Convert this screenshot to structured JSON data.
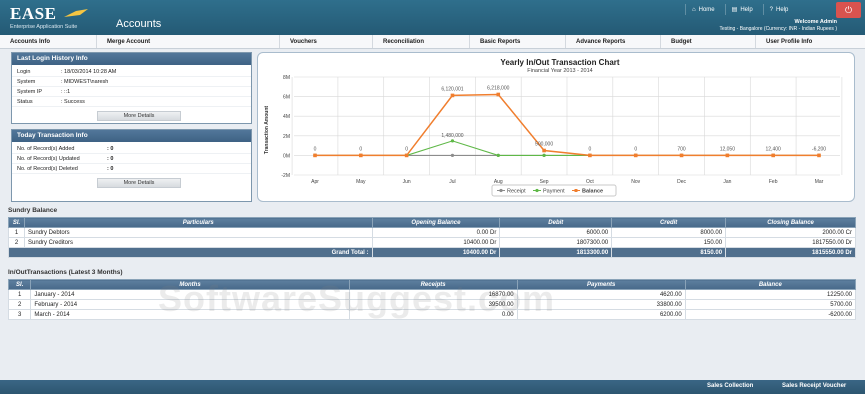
{
  "header": {
    "logo": "EASE",
    "logo_sub": "Enterprise Application Suite",
    "page_title": "Accounts",
    "links": [
      {
        "label": "Home",
        "icon": "home-icon"
      },
      {
        "label": "Help",
        "icon": "book-icon"
      },
      {
        "label": "Help",
        "icon": "question-icon"
      }
    ],
    "welcome": "Welcome Admin",
    "welcome_sub": "Testing - Bangalore (Currency: INR - Indian Rupees )"
  },
  "menu": [
    "Accounts Info",
    "Merge Account",
    "Vouchers",
    "Reconciliation",
    "Basic Reports",
    "Advance Reports",
    "Budget",
    "User Profile Info"
  ],
  "login_panel": {
    "title": "Last Login History Info",
    "rows": [
      {
        "key": "Login",
        "value": ": 18/03/2014 10:28 AM"
      },
      {
        "key": "System",
        "value": ": MIDWEST\\naresh"
      },
      {
        "key": "System IP",
        "value": ": ::1"
      },
      {
        "key": "Status",
        "value": ": Success"
      }
    ],
    "button": "More Details"
  },
  "transaction_panel": {
    "title": "Today Transaction Info",
    "rows": [
      {
        "key": "No. of Record(s) Added",
        "value": ": 0"
      },
      {
        "key": "No. of Record(s) Updated",
        "value": ": 0"
      },
      {
        "key": "No. of Record(s) Deleted",
        "value": ": 0"
      }
    ],
    "button": "More Details"
  },
  "chart_data": {
    "type": "line",
    "title": "Yearly In/Out Transaction Chart",
    "subtitle": "Financial Year 2013 - 2014",
    "ylabel": "Transaction Amount",
    "xlabel": "",
    "categories": [
      "Apr",
      "May",
      "Jun",
      "Jul",
      "Aug",
      "Sep",
      "Oct",
      "Nov",
      "Dec",
      "Jan",
      "Feb",
      "Mar"
    ],
    "ylim": [
      -2000000,
      8000000
    ],
    "yticks": [
      "8M",
      "6M",
      "4M",
      "2M",
      "0M",
      "-2M"
    ],
    "grid": true,
    "legend_position": "bottom",
    "series": [
      {
        "name": "Receipt",
        "color": "#8c8c8c",
        "values": [
          0,
          0,
          0,
          0,
          0,
          0,
          0,
          0,
          0,
          0,
          0,
          0
        ]
      },
      {
        "name": "Payment",
        "color": "#5fb847",
        "values": [
          0,
          0,
          0,
          1480000,
          0,
          0,
          0,
          0,
          0,
          0,
          0,
          0
        ]
      },
      {
        "name": "Balance",
        "color": "#f07e2e",
        "values": [
          0,
          0,
          0,
          6120000,
          6218000,
          500000,
          0,
          0,
          0,
          0,
          0,
          0
        ]
      }
    ],
    "data_labels": [
      "0",
      "0",
      "0",
      "6,120,001",
      "6,218,000",
      "500,000",
      "0",
      "0",
      "700",
      "12,050",
      "12,400",
      "-6,200"
    ],
    "payment_label": "1,480,000",
    "zero_labels": [
      "0",
      "0"
    ]
  },
  "sundry": {
    "title": "Sundry Balance",
    "headers": [
      "Sl.",
      "Particulars",
      "Opening Balance",
      "Debit",
      "Credit",
      "Closing Balance"
    ],
    "rows": [
      [
        "1",
        "Sundry Debtors",
        "0.00 Dr",
        "6000.00",
        "8000.00",
        "2000.00 Cr"
      ],
      [
        "2",
        "Sundry Creditors",
        "10400.00 Dr",
        "1807300.00",
        "150.00",
        "1817550.00 Dr"
      ]
    ],
    "total_label": "Grand Total :",
    "total": [
      "10400.00 Dr",
      "1813300.00",
      "8150.00",
      "1815550.00 Dr"
    ]
  },
  "inout": {
    "title": "In/OutTransactions (Latest 3 Months)",
    "headers": [
      "Sl.",
      "Months",
      "Receipts",
      "Payments",
      "Balance"
    ],
    "rows": [
      [
        "1",
        "January - 2014",
        "16870.00",
        "4620.00",
        "12250.00"
      ],
      [
        "2",
        "February - 2014",
        "39500.00",
        "33800.00",
        "5700.00"
      ],
      [
        "3",
        "March - 2014",
        "0.00",
        "6200.00",
        "-6200.00"
      ]
    ]
  },
  "watermark": "SoftwareSuggest.com",
  "footer": {
    "links": [
      "Sales Collection",
      "Sales Receipt Voucher"
    ]
  }
}
